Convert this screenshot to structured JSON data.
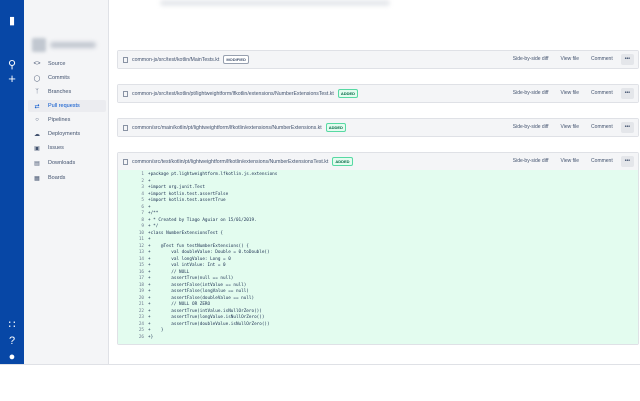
{
  "nav": {
    "items": [
      {
        "label": "Source",
        "icon": "code-icon"
      },
      {
        "label": "Commits",
        "icon": "commit-icon"
      },
      {
        "label": "Branches",
        "icon": "branch-icon"
      },
      {
        "label": "Pull requests",
        "icon": "pull-request-icon"
      },
      {
        "label": "Pipelines",
        "icon": "pipelines-icon"
      },
      {
        "label": "Deployments",
        "icon": "deploy-icon"
      },
      {
        "label": "Issues",
        "icon": "issues-icon"
      },
      {
        "label": "Downloads",
        "icon": "download-icon"
      },
      {
        "label": "Boards",
        "icon": "board-icon"
      }
    ]
  },
  "buttons": {
    "side_by_side": "Side-by-side diff",
    "view_file": "View file",
    "comment": "Comment",
    "more": "•••"
  },
  "files": [
    {
      "path": "common-js/src/test/kotlin/MainTests.kt",
      "badge": "MODIFIED"
    },
    {
      "path": "common-js/src/test/kotlin/pt/lightweightform/lfkotlin/extensions/NumberExtensionsTest.kt",
      "badge": "ADDED"
    },
    {
      "path": "common/src/main/kotlin/pt/lightweightform/lfkotlin/extensions/NumberExtensions.kt",
      "badge": "ADDED"
    },
    {
      "path": "common/src/test/kotlin/pt/lightweightform/lfkotlin/extensions/NumberExtensionsTest.kt",
      "badge": "ADDED"
    }
  ],
  "diff_lines": [
    {
      "n": "1",
      "code": "+package pt.lightweightform.lfkotlin.js.extensions"
    },
    {
      "n": "2",
      "code": "+"
    },
    {
      "n": "3",
      "code": "+import org.junit.Test"
    },
    {
      "n": "4",
      "code": "+import kotlin.test.assertFalse"
    },
    {
      "n": "5",
      "code": "+import kotlin.test.assertTrue"
    },
    {
      "n": "6",
      "code": "+"
    },
    {
      "n": "7",
      "code": "+/**"
    },
    {
      "n": "8",
      "code": "+ * Created by Tiago Aguiar on 15/01/2019."
    },
    {
      "n": "9",
      "code": "+ */"
    },
    {
      "n": "10",
      "code": "+class NumberExtensionsTest {"
    },
    {
      "n": "11",
      "code": "+"
    },
    {
      "n": "12",
      "code": "+    @Test fun testNumberExtensions() {"
    },
    {
      "n": "13",
      "code": "+        val doubleValue: Double = 0.toDouble()"
    },
    {
      "n": "14",
      "code": "+        val longValue: Long = 0"
    },
    {
      "n": "15",
      "code": "+        val intValue: Int = 0"
    },
    {
      "n": "16",
      "code": "+        // NULL"
    },
    {
      "n": "17",
      "code": "+        assertTrue(null == null)"
    },
    {
      "n": "18",
      "code": "+        assertFalse(intValue == null)"
    },
    {
      "n": "19",
      "code": "+        assertFalse(longValue == null)"
    },
    {
      "n": "20",
      "code": "+        assertFalse(doubleValue == null)"
    },
    {
      "n": "21",
      "code": "+        // NULL OR ZERO"
    },
    {
      "n": "22",
      "code": "+        assertTrue(intValue.isNullOrZero())"
    },
    {
      "n": "23",
      "code": "+        assertTrue(longValue.isNullOrZero())"
    },
    {
      "n": "24",
      "code": "+        assertTrue(doubleValue.isNullOrZero())"
    },
    {
      "n": "25",
      "code": "+    }"
    },
    {
      "n": "26",
      "code": "+}"
    }
  ]
}
